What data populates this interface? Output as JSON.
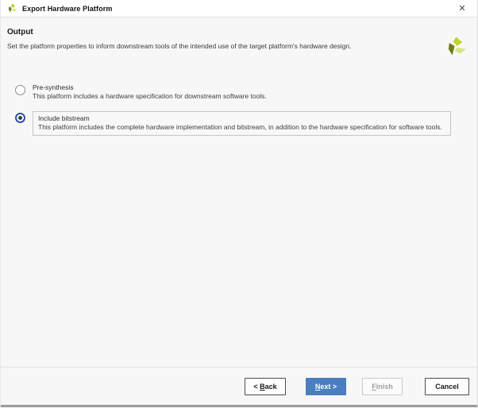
{
  "window": {
    "title": "Export Hardware Platform",
    "close_icon": "✕"
  },
  "header": {
    "title": "Output",
    "description": "Set the platform properties to inform downstream tools of the intended use of the target platform's hardware design."
  },
  "options": [
    {
      "label": "Pre-synthesis",
      "description": "This platform includes a hardware specification for downstream software tools.",
      "selected": false
    },
    {
      "label": "Include bitstream",
      "description": "This platform includes the complete hardware implementation and bitstream, in addition to the hardware specification for software tools.",
      "selected": true
    }
  ],
  "footer": {
    "back": {
      "pre": "< ",
      "underline": "B",
      "post": "ack"
    },
    "next": {
      "pre": "",
      "underline": "N",
      "post": "ext >"
    },
    "finish": {
      "pre": "",
      "underline": "F",
      "post": "inish"
    },
    "cancel_label": "Cancel"
  },
  "colors": {
    "accent_blue": "#4a7ebf",
    "radio_selected_ring": "#2d54a7",
    "logo_dark_olive": "#6f7d1e",
    "logo_lime": "#c1d32f",
    "logo_pale_lime": "#d8e382"
  },
  "icons": {
    "titlebar_logo": "vendor-pinwheel-icon",
    "header_logo": "vendor-pinwheel-icon",
    "close": "close-icon"
  }
}
